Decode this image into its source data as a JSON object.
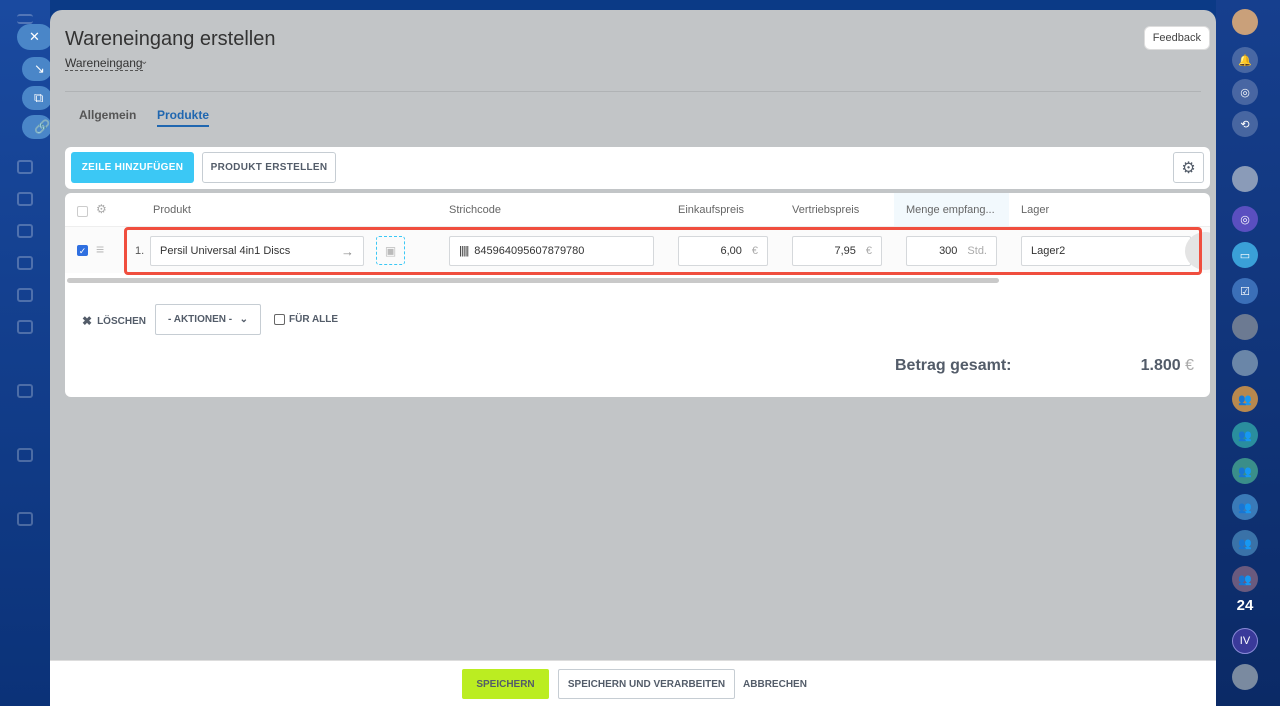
{
  "header": {
    "title": "Wareneingang erstellen",
    "subtitle": "Wareneingang",
    "feedback": "Feedback"
  },
  "tabs": [
    {
      "label": "Allgemein"
    },
    {
      "label": "Produkte"
    }
  ],
  "toolbar": {
    "add_row": "ZEILE HINZUFÜGEN",
    "create_product": "PRODUKT ERSTELLEN"
  },
  "table": {
    "columns": [
      "Produkt",
      "Strichcode",
      "Einkaufspreis",
      "Vertriebspreis",
      "Menge empfang...",
      "Lager"
    ],
    "rows": [
      {
        "index": "1.",
        "product": "Persil Universal 4in1 Discs",
        "barcode": "845964095607879780",
        "purchase_price": "6,00",
        "sale_price": "7,95",
        "currency": "€",
        "quantity": "300",
        "unit": "Std.",
        "warehouse": "Lager2"
      }
    ]
  },
  "actions": {
    "delete": "LÖSCHEN",
    "actions_select": "- AKTIONEN -",
    "for_all": "FÜR ALLE"
  },
  "total": {
    "label": "Betrag gesamt:",
    "value": "1.800",
    "currency": "€"
  },
  "footer": {
    "save": "SPEICHERN",
    "save_process": "SPEICHERN UND VERARBEITEN",
    "cancel": "ABBRECHEN"
  },
  "rightbar": {
    "badge_24": "24",
    "badge_iv": "IV"
  },
  "colors": {
    "accent": "#3bc8f5",
    "save": "#bbed21",
    "highlight": "#f04e3e",
    "link": "#2067b0"
  }
}
